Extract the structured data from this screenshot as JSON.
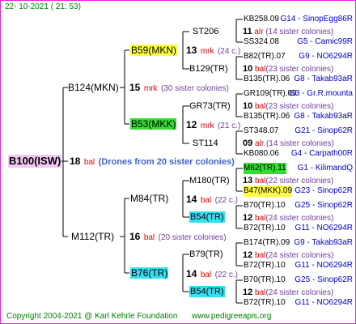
{
  "header": {
    "date": "22- 10-2021 ( 21: 53)"
  },
  "footer": {
    "copyright": "Copyright 2004-2021 @ Karl Kehrle Foundation",
    "site": "www.pedigreeapis.org"
  },
  "root": {
    "name": "B100(ISW)",
    "num": "18",
    "unit": "bal",
    "note": "(Drones from 20 sister colonies)"
  },
  "sire": {
    "name": "B124(MKN)",
    "num": "15",
    "unit": "mrk",
    "note": "(30 sister colonies)",
    "s": {
      "name": "B59(MKN)",
      "num": "13",
      "unit": "mrk",
      "note": "(24 c.)",
      "s": {
        "name": "ST206",
        "num": "11",
        "unit": "alr",
        "note": "(14 sister colonies)"
      },
      "d": {
        "name": "B129(TR)",
        "num": "10",
        "unit": "bal",
        "note": "(23 sister colonies)"
      }
    },
    "d": {
      "name": "B53(MKK)",
      "num": "12",
      "unit": "mrk",
      "note": "(21 c.)",
      "s": {
        "name": "GR73(TR)",
        "num": "10",
        "unit": "bal",
        "note": "(23 sister colonies)"
      },
      "d": {
        "name": "ST114",
        "num": "09",
        "unit": "alr",
        "note": "(14 sister colonies)"
      }
    }
  },
  "dam": {
    "name": "M112(TR)",
    "num": "16",
    "unit": "bal",
    "note": "(20 sister colonies)",
    "s": {
      "name": "M84(TR)",
      "num": "14",
      "unit": "bal",
      "note": "(22 c.)",
      "s": {
        "name": "M180(TR)",
        "num": "13",
        "unit": "bal",
        "note": "(22 sister colonies)"
      },
      "d": {
        "name": "B54(TR)",
        "num": "12",
        "unit": "bal",
        "note": "(24 sister colonies)"
      }
    },
    "d": {
      "name": "B76(TR)",
      "num": "14",
      "unit": "bal",
      "note": "(22 c.)",
      "s": {
        "name": "B79(TR)",
        "num": "12",
        "unit": "bal",
        "note": "(24 sister colonies)"
      },
      "d": {
        "name": "B54(TR)",
        "num": "12",
        "unit": "bal",
        "note": "(24 sister colonies)"
      }
    }
  },
  "ancestors": [
    {
      "name": "KB258.09",
      "ref": "G14 - SinopEgg86R"
    },
    {
      "name": "SS324.08",
      "ref": "G5 - Camic99R"
    },
    {
      "name": "B82(TR).07",
      "ref": "G9 - NO6294R"
    },
    {
      "name": "B135(TR).06",
      "ref": "G8 - Takab93aR"
    },
    {
      "name": "GR109(TR).09",
      "ref": "G3 - Gr.R.mounta"
    },
    {
      "name": "B135(TR).06",
      "ref": "G8 - Takab93aR"
    },
    {
      "name": "ST348.07",
      "ref": "G21 - Sinop62R"
    },
    {
      "name": "KB080.06",
      "ref": "G4 - Carpath00R"
    },
    {
      "name": "M62(TR).11",
      "ref": "G1 - KilimandQ"
    },
    {
      "name": "B47(MKK).09",
      "ref": "G23 - Sinop62R"
    },
    {
      "name": "B70(TR).10",
      "ref": "G25 - Sinop62R"
    },
    {
      "name": "B72(TR).10",
      "ref": "G11 - NO6294R"
    },
    {
      "name": "B174(TR).09",
      "ref": "G9 - Takab93aR"
    },
    {
      "name": "B72(TR).10",
      "ref": "G11 - NO6294R"
    },
    {
      "name": "B70(TR).10",
      "ref": "G25 - Sinop62R"
    },
    {
      "name": "B72(TR).10",
      "ref": "G11 - NO6294R"
    }
  ]
}
